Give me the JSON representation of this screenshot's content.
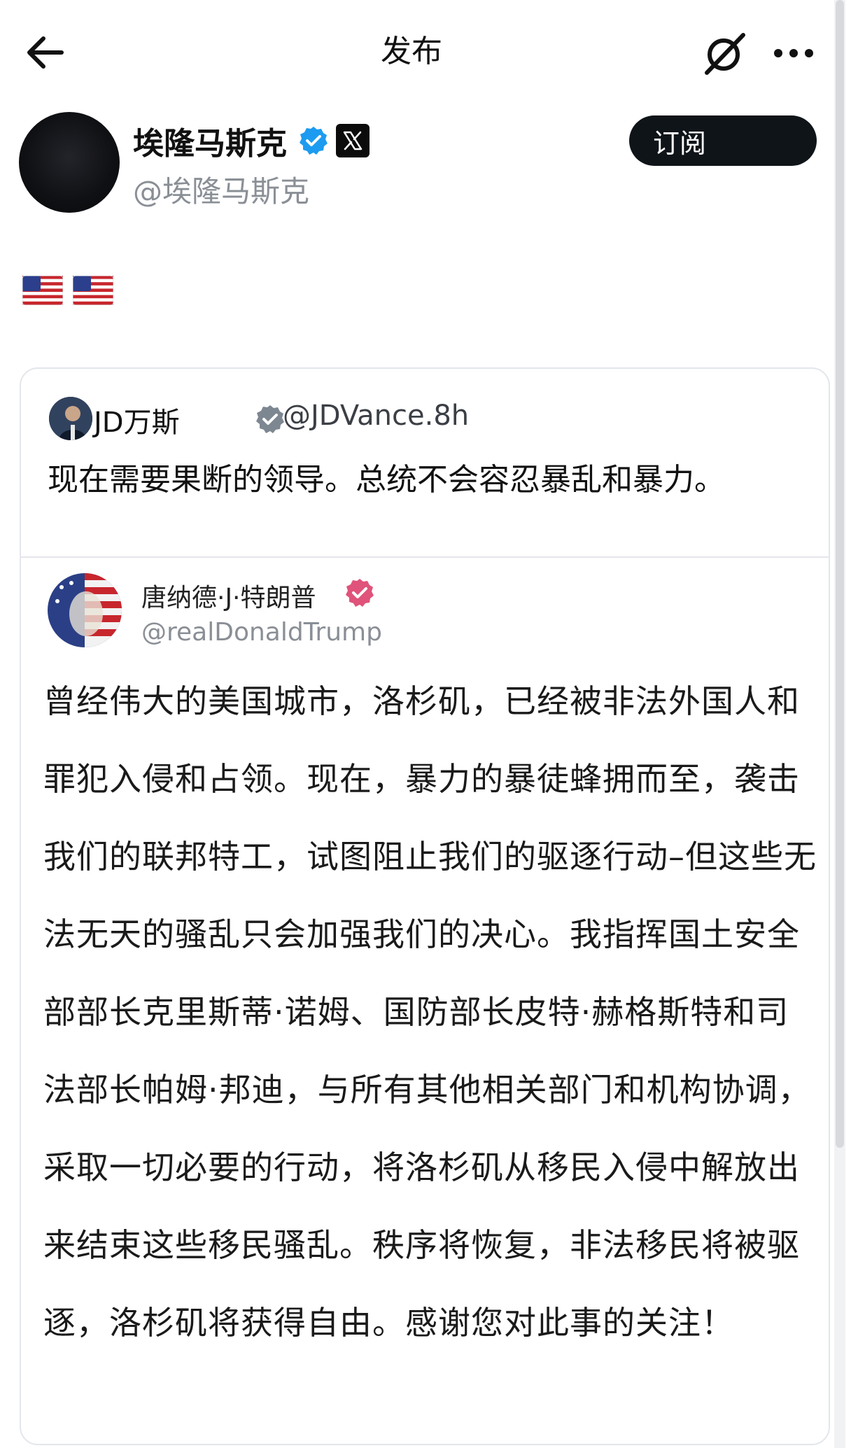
{
  "header": {
    "title": "发布",
    "back_icon": "arrow-left-icon",
    "grok_icon": "grok-slash-icon",
    "more_icon": "more-dots-icon"
  },
  "author": {
    "name": "埃隆马斯克",
    "handle": "@埃隆马斯克",
    "verified_icon": "verified-blue-icon",
    "affiliate_icon": "x-logo-icon",
    "subscribe_label": "订阅"
  },
  "post": {
    "flags": [
      "🇺🇸",
      "🇺🇸"
    ]
  },
  "quote": {
    "name": "JD万斯",
    "handle": "@JDVance.8h",
    "text": "现在需要果断的领导。总统不会容忍暴乱和暴力。",
    "nested": {
      "name": "唐纳德·J·特朗普",
      "handle": "@realDonaldTrump",
      "text": "曾经伟大的美国城市，洛杉矶，已经被非法外国人和罪犯入侵和占领。现在，暴力的暴徒蜂拥而至，袭击我们的联邦特工，试图阻止我们的驱逐行动–但这些无法无天的骚乱只会加强我们的决心。我指挥国土安全部部长克里斯蒂·诺姆、国防部长皮特·赫格斯特和司法部长帕姆·邦迪，与所有其他相关部门和机构协调，采取一切必要的行动，将洛杉矶从移民入侵中解放出来结束这些移民骚乱。秩序将恢复，非法移民将被驱逐，洛杉矶将获得自由。感谢您对此事的关注！"
    }
  },
  "colors": {
    "verified_blue": "#1d9bf0",
    "subscribe_bg": "#0f1419",
    "handle_gray": "#8a8f96",
    "border": "#e3e6ea",
    "verified_gray": "#7d8791"
  }
}
